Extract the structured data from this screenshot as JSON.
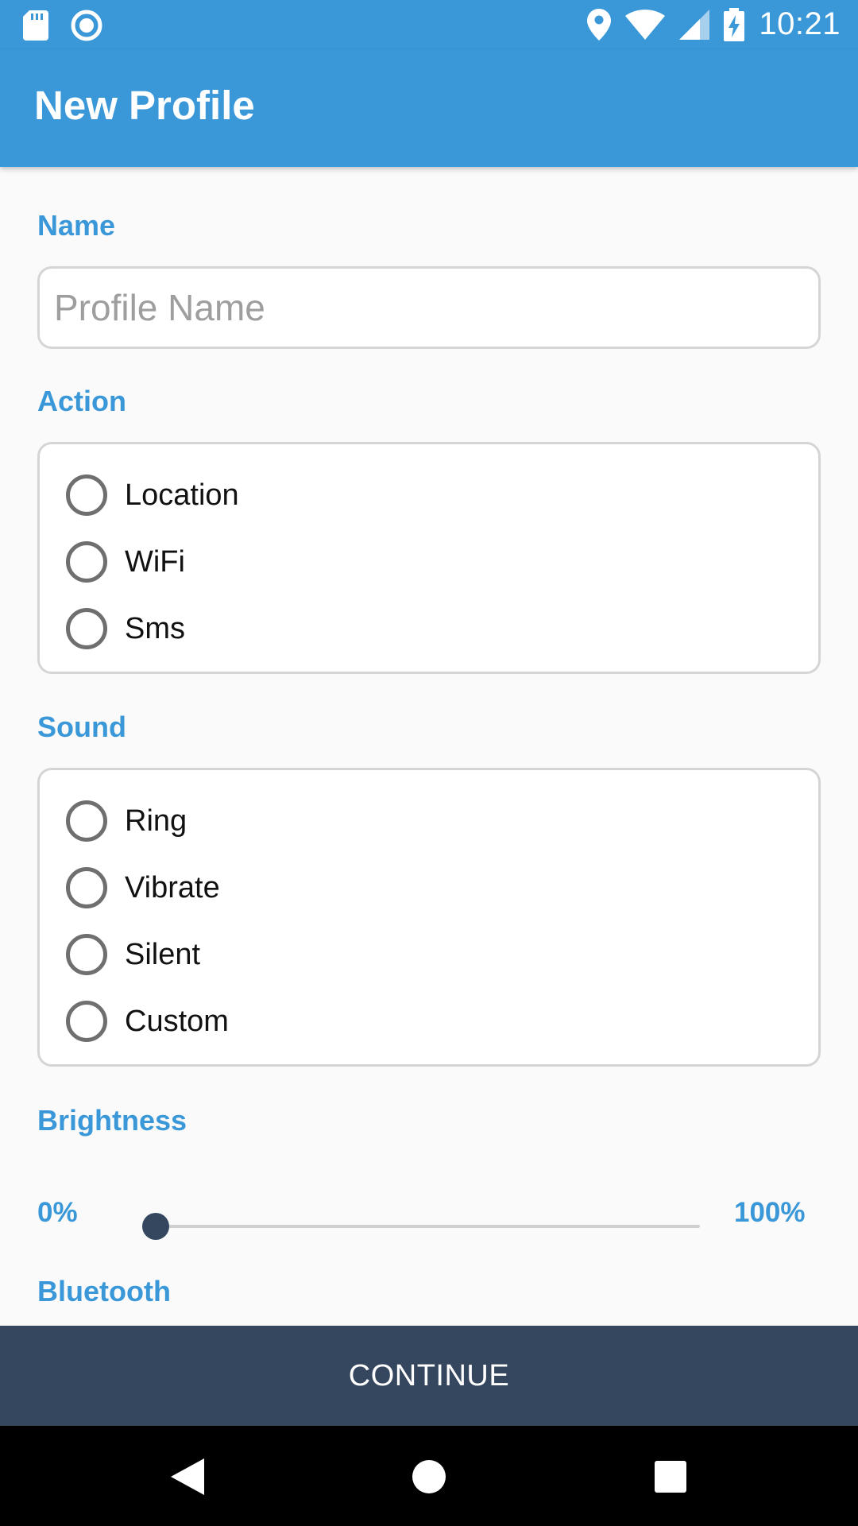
{
  "status_bar": {
    "time": "10:21",
    "left_icons": [
      "sd-card-icon",
      "sync-icon"
    ],
    "right_icons": [
      "location-icon",
      "wifi-icon",
      "signal-icon",
      "battery-charging-icon"
    ]
  },
  "app_bar": {
    "title": "New Profile"
  },
  "form": {
    "name": {
      "label": "Name",
      "placeholder": "Profile Name",
      "value": ""
    },
    "action": {
      "label": "Action",
      "options": [
        {
          "label": "Location",
          "selected": false
        },
        {
          "label": "WiFi",
          "selected": false
        },
        {
          "label": "Sms",
          "selected": false
        }
      ]
    },
    "sound": {
      "label": "Sound",
      "options": [
        {
          "label": "Ring",
          "selected": false
        },
        {
          "label": "Vibrate",
          "selected": false
        },
        {
          "label": "Silent",
          "selected": false
        },
        {
          "label": "Custom",
          "selected": false
        }
      ]
    },
    "brightness": {
      "label": "Brightness",
      "min_label": "0%",
      "max_label": "100%",
      "value_percent": 0
    },
    "bluetooth": {
      "label": "Bluetooth"
    }
  },
  "continue_button": {
    "label": "CONTINUE"
  },
  "nav_bar": {
    "icons": [
      "back-icon",
      "home-icon",
      "recents-icon"
    ]
  },
  "colors": {
    "primary": "#3a98d9",
    "dark": "#35475e",
    "radio_border": "#6f6f6f",
    "field_border": "#d5d5d5"
  }
}
